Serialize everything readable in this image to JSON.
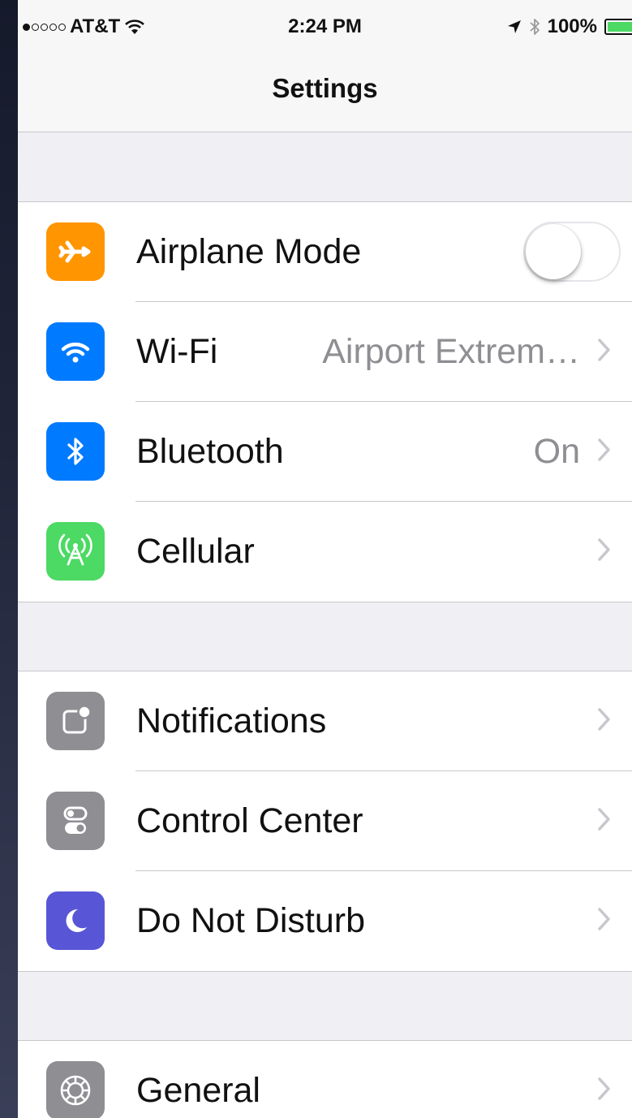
{
  "status_bar": {
    "carrier": "AT&T",
    "time": "2:24 PM",
    "battery": "100%",
    "signal_bars_filled": 1,
    "battery_level": 1.0
  },
  "nav": {
    "title": "Settings"
  },
  "groups": [
    {
      "rows": [
        {
          "label": "Airplane Mode",
          "icon": "airplane-icon",
          "color": "#ff9500",
          "control": "toggle",
          "toggle_on": false
        },
        {
          "label": "Wi-Fi",
          "detail": "Airport Extrem…",
          "icon": "wifi-icon",
          "color": "#007aff",
          "control": "chevron"
        },
        {
          "label": "Bluetooth",
          "detail": "On",
          "icon": "bluetooth-icon",
          "color": "#007aff",
          "control": "chevron"
        },
        {
          "label": "Cellular",
          "icon": "cellular-antenna-icon",
          "color": "#4cd964",
          "control": "chevron"
        }
      ]
    },
    {
      "rows": [
        {
          "label": "Notifications",
          "icon": "notifications-icon",
          "color": "#8e8e93",
          "control": "chevron"
        },
        {
          "label": "Control Center",
          "icon": "control-center-icon",
          "color": "#8e8e93",
          "control": "chevron"
        },
        {
          "label": "Do Not Disturb",
          "icon": "moon-icon",
          "color": "#5856d6",
          "control": "chevron"
        }
      ]
    },
    {
      "rows": [
        {
          "label": "General",
          "icon": "gear-icon",
          "color": "#8e8e93",
          "control": "chevron"
        }
      ]
    }
  ]
}
